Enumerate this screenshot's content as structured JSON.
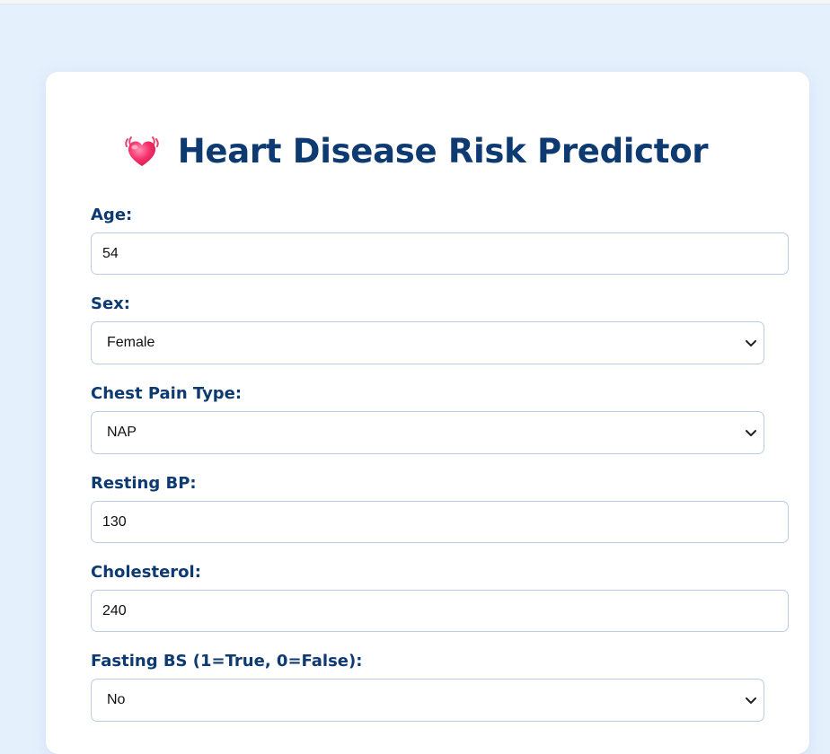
{
  "page": {
    "title": "Heart Disease Risk Predictor",
    "title_icon": "beating-heart-emoji",
    "colors": {
      "background": "#e5f0fd",
      "card": "#ffffff",
      "heading": "#0e3a72",
      "border": "#b9cde3"
    }
  },
  "form": {
    "age": {
      "label": "Age:",
      "value": "54"
    },
    "sex": {
      "label": "Sex:",
      "value": "Female"
    },
    "chest_pain": {
      "label": "Chest Pain Type:",
      "value": "NAP"
    },
    "resting_bp": {
      "label": "Resting BP:",
      "value": "130"
    },
    "cholesterol": {
      "label": "Cholesterol:",
      "value": "240"
    },
    "fasting_bs": {
      "label": "Fasting BS (1=True, 0=False):",
      "value": "No"
    }
  }
}
